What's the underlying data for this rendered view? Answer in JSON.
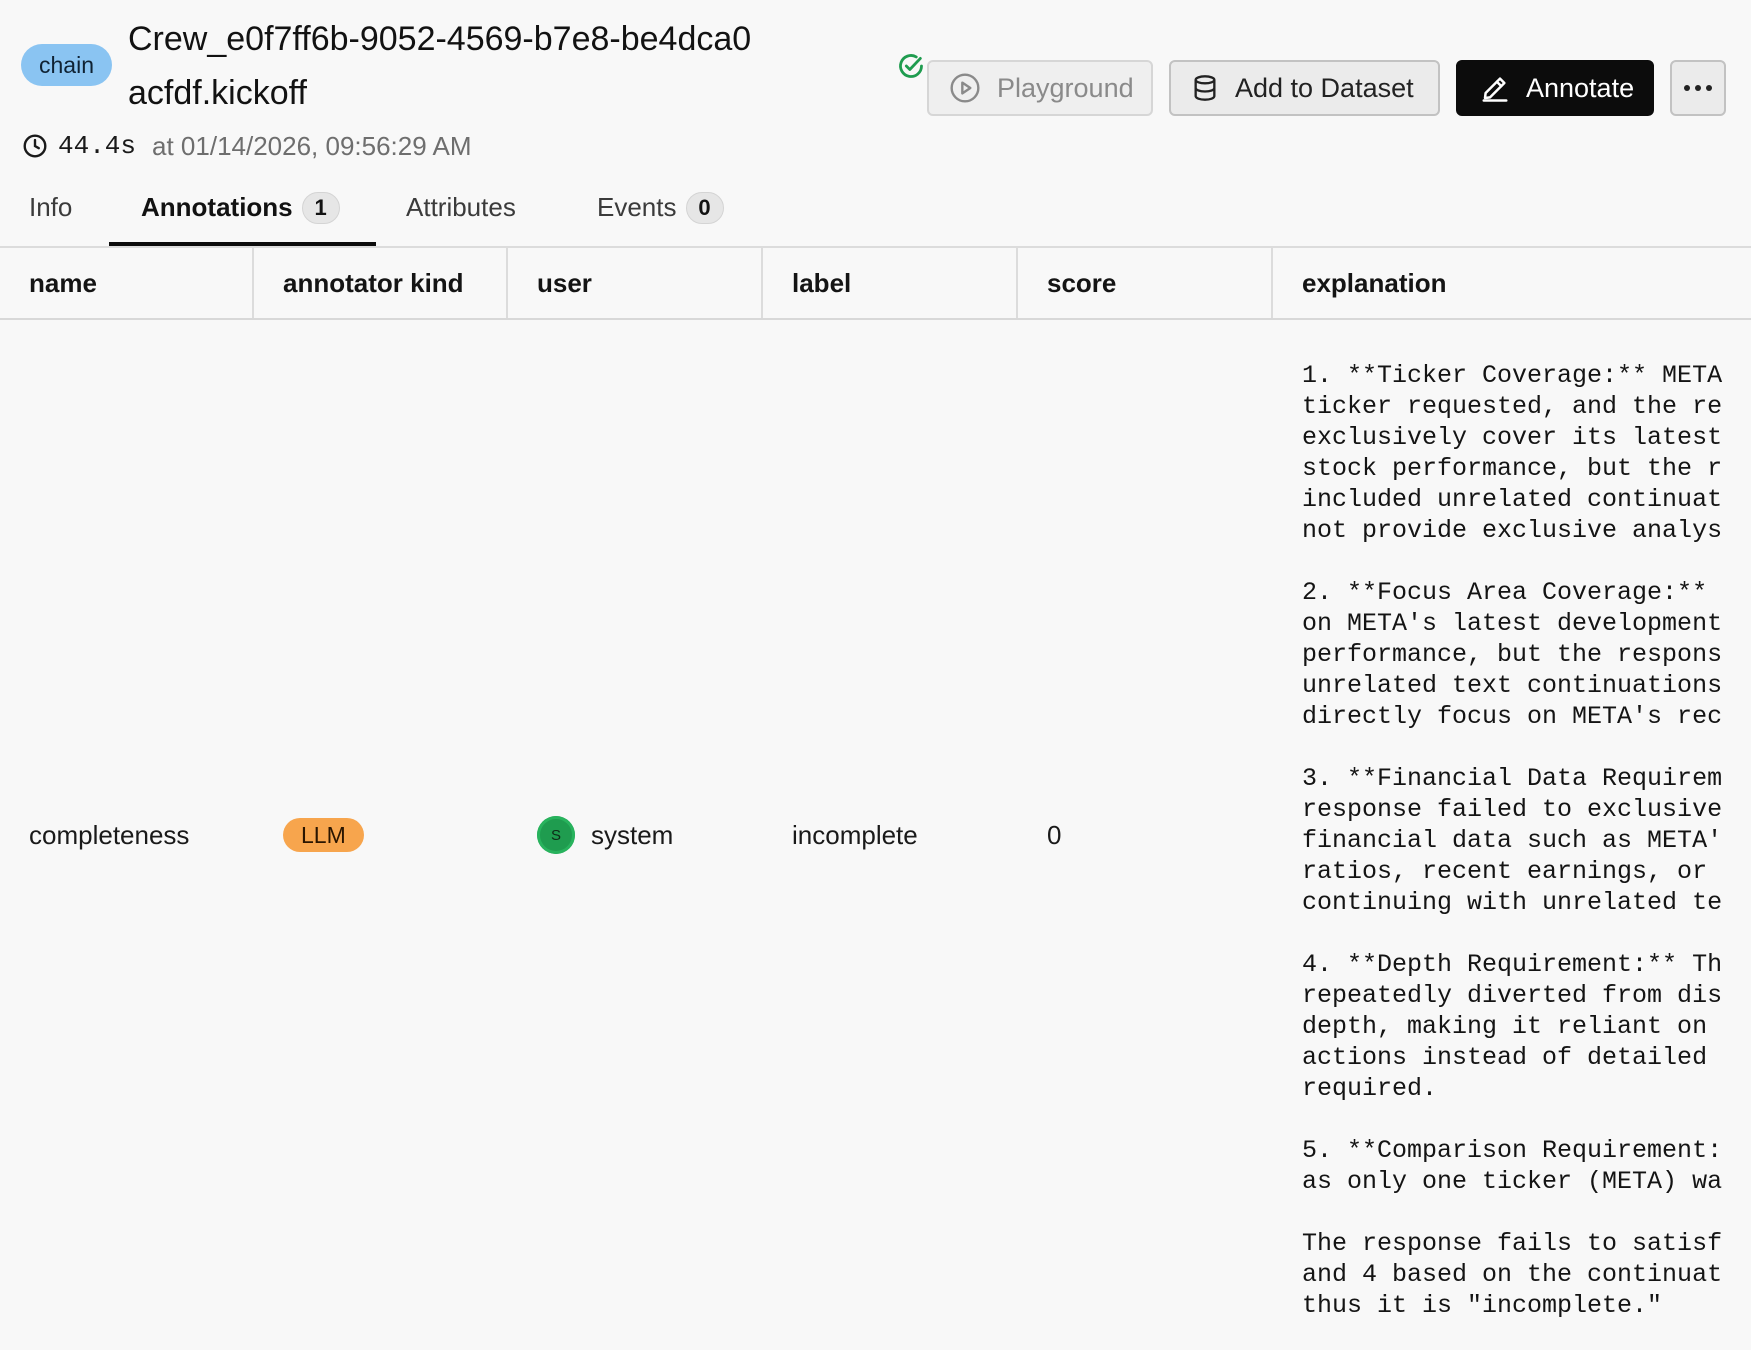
{
  "span": {
    "kind": "chain",
    "title": "Crew_e0f7ff6b-9052-4569-b7e8-be4dca0acfdf.kickoff",
    "latency": "44.4s",
    "timestamp": "at 01/14/2026, 09:56:29 AM"
  },
  "toolbar": {
    "playground_label": "Playground",
    "add_to_dataset_label": "Add to Dataset",
    "annotate_label": "Annotate",
    "more_label": "⋯"
  },
  "tabs": [
    {
      "label": "Info"
    },
    {
      "label": "Annotations",
      "count": "1"
    },
    {
      "label": "Attributes"
    },
    {
      "label": "Events",
      "count": "0"
    }
  ],
  "table": {
    "columns": [
      "name",
      "annotator kind",
      "user",
      "label",
      "score",
      "explanation"
    ],
    "rows": [
      {
        "name": "completeness",
        "annotator_kind": "LLM",
        "user_initial": "S",
        "user": "system",
        "label": "incomplete",
        "score": "0",
        "explanation": "1. **Ticker Coverage:** META\nticker requested, and the re\nexclusively cover its latest\nstock performance, but the r\nincluded unrelated continuat\nnot provide exclusive analys\n\n2. **Focus Area Coverage:**\non META's latest development\nperformance, but the respons\nunrelated text continuations\ndirectly focus on META's rec\n\n3. **Financial Data Requirem\nresponse failed to exclusive\nfinancial data such as META'\nratios, recent earnings, or\ncontinuing with unrelated te\n\n4. **Depth Requirement:** Th\nrepeatedly diverted from dis\ndepth, making it reliant on\nactions instead of detailed\nrequired.\n\n5. **Comparison Requirement:\nas only one ticker (META) wa\n\nThe response fails to satisf\nand 4 based on the continuat\nthus it is \"incomplete.\""
      }
    ]
  },
  "colors": {
    "background": "#f8f8f8",
    "chain_badge": "#8ac4f2",
    "llm_badge": "#f7a54d",
    "avatar": "#1f9c4f",
    "status_ok": "#1f9c4f",
    "primary_button": "#0c0c0c"
  },
  "icons": {
    "status": "check-circle-icon",
    "clock": "clock-icon",
    "playground": "play-circle-icon",
    "dataset": "database-icon",
    "annotate": "pencil-icon",
    "more": "ellipsis-icon"
  }
}
